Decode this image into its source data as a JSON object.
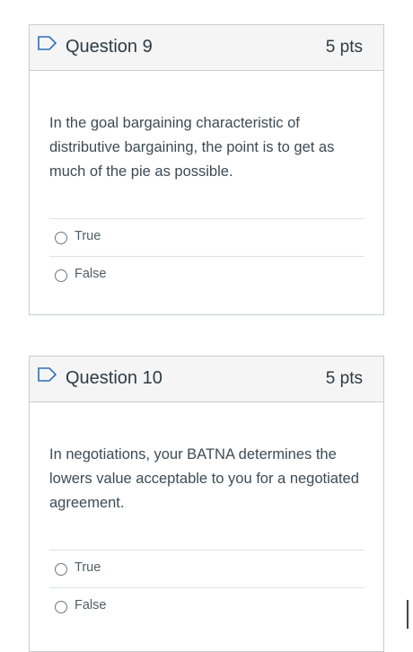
{
  "questions": [
    {
      "title": "Question 9",
      "points": "5 pts",
      "text": "In the goal bargaining characteristic of distributive bargaining, the point is to get as much of the pie as possible.",
      "answers": [
        "True",
        "False"
      ]
    },
    {
      "title": "Question 10",
      "points": "5 pts",
      "text": "In negotiations, your BATNA determines the lowers value acceptable to you for a negotiated agreement.",
      "answers": [
        "True",
        "False"
      ]
    }
  ],
  "colors": {
    "flag": "#2d6fb7",
    "header_bg": "#f5f5f5",
    "border": "#c7cdd1"
  },
  "icons": {
    "flag": "flag-outline-icon",
    "radio": "radio-unchecked-icon"
  }
}
